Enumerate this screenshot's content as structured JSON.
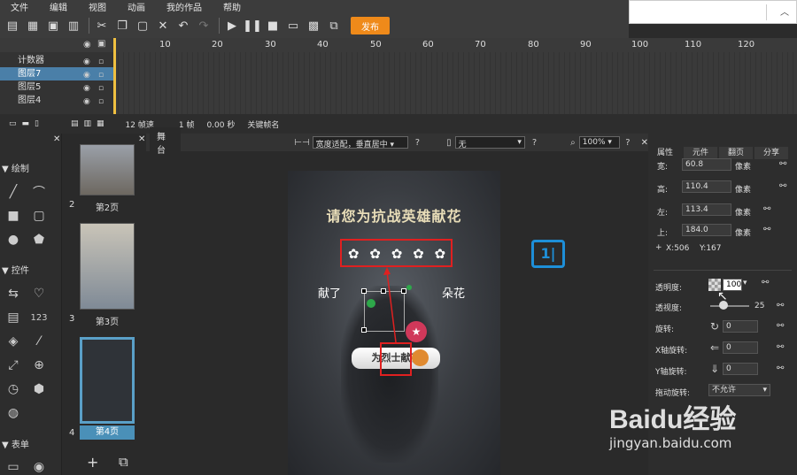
{
  "menu": [
    "文件",
    "编辑",
    "视图",
    "动画",
    "我的作品",
    "帮助"
  ],
  "toolbar": {
    "publish_label": "发布"
  },
  "timeline": {
    "ruler": [
      "10",
      "20",
      "30",
      "40",
      "50",
      "60",
      "70",
      "80",
      "90",
      "100",
      "110",
      "120"
    ],
    "layers": [
      {
        "label": "计数器",
        "selected": false
      },
      {
        "label": "图层7",
        "selected": true
      },
      {
        "label": "图层5",
        "selected": false
      },
      {
        "label": "图层4",
        "selected": false
      }
    ],
    "status": {
      "fps": "12 帧速",
      "frame": "1 帧",
      "time": "0.00 秒",
      "keyframe_label": "关键帧名"
    }
  },
  "tools": {
    "draw_label": "绘制",
    "controls_label": "控件",
    "forms_label": "表单",
    "counter_text": "123"
  },
  "pages": [
    {
      "num": "2",
      "label": "第2页"
    },
    {
      "num": "3",
      "label": "第3页"
    },
    {
      "num": "4",
      "label": "第4页"
    }
  ],
  "stage": {
    "tab_label": "舞台",
    "fit_mode": "宽度适配，垂直居中",
    "device": "无",
    "zoom": "100%",
    "phone": {
      "title": "请您为抗战英雄献花",
      "left_text": "献了",
      "right_text": "朵花",
      "button_text": "为烈士献花"
    }
  },
  "props": {
    "tabs": [
      "属性",
      "元件",
      "翻页",
      "分享"
    ],
    "width_label": "宽:",
    "width_value": "60.8",
    "unit": "像素",
    "height_label": "高:",
    "height_value": "110.4",
    "left_label": "左:",
    "left_value": "113.4",
    "top_label": "上:",
    "top_value": "184.0",
    "coord_x": "X:506",
    "coord_y": "Y:167",
    "opacity_label": "透明度:",
    "opacity_value": "100",
    "perspective_label": "透视度:",
    "perspective_value": "25",
    "rotate_label": "旋转:",
    "rotate_value": "0",
    "xrot_label": "X轴旋转:",
    "xrot_value": "0",
    "yrot_label": "Y轴旋转:",
    "yrot_value": "0",
    "drag_label": "拖动旋转:",
    "drag_value": "不允许"
  },
  "watermark": {
    "brand": "Baidu经验",
    "url": "jingyan.baidu.com"
  },
  "colors": {
    "publish": "#ef8a1a",
    "selection": "#4a7fa8",
    "highlight": "#e02020"
  }
}
